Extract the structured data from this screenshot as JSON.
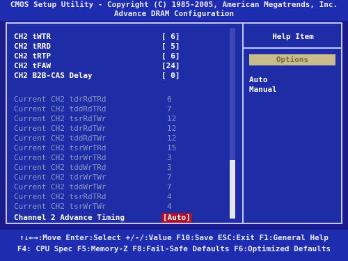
{
  "header": {
    "app_title": "CMOS Setup Utility - Copyright (C) 1985-2005, American Megatrends, Inc.",
    "page_title": "Advance DRAM Configuration"
  },
  "settings": [
    {
      "label": "CH2 tWTR",
      "value": "[ 6]"
    },
    {
      "label": "CH2 tRRD",
      "value": "[ 5]"
    },
    {
      "label": "CH2 tRTP",
      "value": "[ 6]"
    },
    {
      "label": "CH2 tFAW",
      "value": "[24]"
    },
    {
      "label": "CH2 B2B-CAS Delay",
      "value": "[ 0]"
    }
  ],
  "readonly": [
    {
      "label": "Current CH2 tdrRdTRd",
      "value": "6"
    },
    {
      "label": "Current CH2 tddRdTRd",
      "value": "7"
    },
    {
      "label": "Current CH2 tsrRdTWr",
      "value": "12"
    },
    {
      "label": "Current CH2 tdrRdTWr",
      "value": "12"
    },
    {
      "label": "Current CH2 tddRdTWr",
      "value": "12"
    },
    {
      "label": "Current CH2 tsrWrTRd",
      "value": "15"
    },
    {
      "label": "Current CH2 tdrWrTRd",
      "value": "3"
    },
    {
      "label": "Current CH2 tddWrTRd",
      "value": "3"
    },
    {
      "label": "Current CH2 tdrWrTWr",
      "value": "7"
    },
    {
      "label": "Current CH2 tddWrTWr",
      "value": "7"
    },
    {
      "label": "Current CH2 tsrRdTRd",
      "value": "4"
    },
    {
      "label": "Current CH2 tsrWrTWr",
      "value": "4"
    }
  ],
  "selected": {
    "label": "Channel 2 Advance Timing",
    "value": "[Auto]"
  },
  "help": {
    "title": "Help Item",
    "options_header": "Options",
    "options": [
      "Auto",
      "Manual"
    ]
  },
  "footer": {
    "line1": "↑↓←→:Move  Enter:Select  +/-/:Value  F10:Save  ESC:Exit  F1:General Help",
    "line2": "F4: CPU Spec  F5:Memory-Z  F8:Fail-Safe Defaults  F6:Optimized Defaults"
  },
  "colors": {
    "background": "#1a1a8a",
    "panel": "#1e2ca6",
    "selected_value_bg": "#b0102a",
    "options_header_bg": "#c8bc8c"
  }
}
